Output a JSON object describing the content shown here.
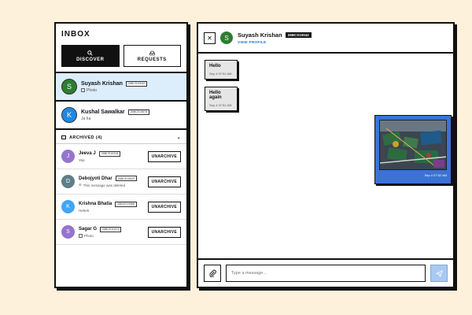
{
  "inbox": {
    "title": "INBOX",
    "discover_label": "DISCOVER",
    "requests_label": "REQUESTS"
  },
  "chats": [
    {
      "name": "Suyash Krishan",
      "roll": "26BCS10042",
      "initial": "S",
      "color": "#2e7d32",
      "preview": "Photo"
    },
    {
      "name": "Kushal Sawalkar",
      "roll": "26BCE10678",
      "initial": "K",
      "color": "#1e88e5",
      "preview": "Ja ha"
    }
  ],
  "archived": {
    "label": "ARCHIVED (4)",
    "items": [
      {
        "name": "Jeeva J",
        "roll": "26BCE10318",
        "initial": "J",
        "color": "#9575cd",
        "preview": "Yep",
        "action": "UNARCHIVE"
      },
      {
        "name": "Debojyoti Dhar",
        "roll": "26BCE10620",
        "initial": "D",
        "color": "#607d8b",
        "preview": "This message was deleted",
        "action": "UNARCHIVE"
      },
      {
        "name": "Krishna Bhatia",
        "roll": "26BCE10068",
        "initial": "K",
        "color": "#42a5f5",
        "preview": "Heheh",
        "action": "UNARCHIVE"
      },
      {
        "name": "Sagar G",
        "roll": "26BCE10221",
        "initial": "S",
        "color": "#9575cd",
        "preview": "Photo",
        "action": "UNARCHIVE"
      }
    ]
  },
  "conversation": {
    "name": "Suyash Krishan",
    "roll": "26BCS10042",
    "initial": "S",
    "view_profile": "VIEW PROFILE",
    "close_glyph": "✕",
    "messages": [
      {
        "text": "Hello",
        "time": "Sep 4 07:51 AM"
      },
      {
        "text": "Hello again",
        "time": "Sep 4 07:51 AM"
      }
    ],
    "image_time": "Sep 4 07:52 AM"
  },
  "composer": {
    "placeholder": "Type a message..."
  },
  "colors": {
    "background": "#fdf1dc",
    "selected": "#dcedfb",
    "accent": "#3a73d6"
  }
}
